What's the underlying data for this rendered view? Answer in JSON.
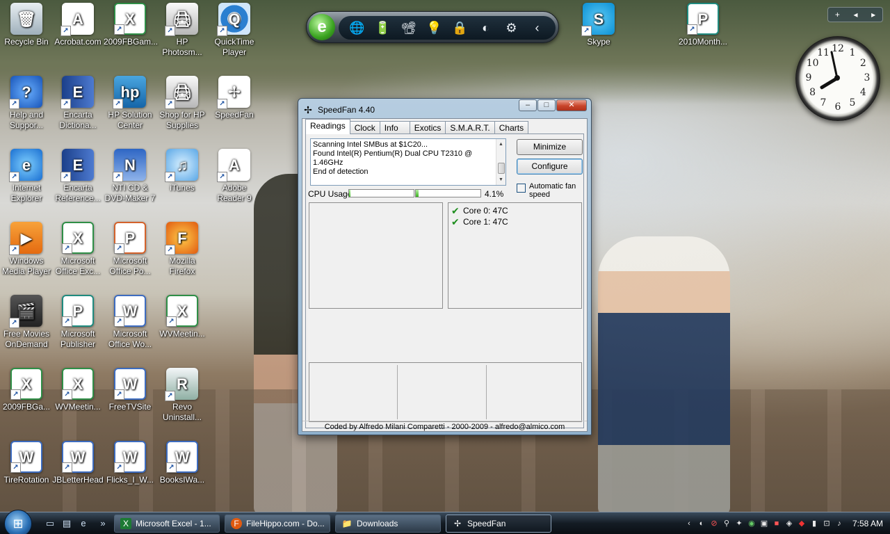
{
  "desktop": {
    "icons": [
      {
        "label": "Recycle Bin",
        "glyph": "🗑"
      },
      {
        "label": "Acrobat.com",
        "glyph": "A"
      },
      {
        "label": "2009FBGam...",
        "glyph": "X"
      },
      {
        "label": "HP Photosm...",
        "glyph": "🖨"
      },
      {
        "label": "QuickTime Player",
        "glyph": "Q"
      },
      {
        "label": "Help and Suppor...",
        "glyph": "?"
      },
      {
        "label": "Encarta Dictiona...",
        "glyph": "E"
      },
      {
        "label": "HP Solution Center",
        "glyph": "hp"
      },
      {
        "label": "Shop for HP Supplies",
        "glyph": "🖨"
      },
      {
        "label": "SpeedFan",
        "glyph": "✢"
      },
      {
        "label": "Internet Explorer",
        "glyph": "e"
      },
      {
        "label": "Encarta Reference...",
        "glyph": "E"
      },
      {
        "label": "NTI CD & DVD-Maker 7",
        "glyph": "N"
      },
      {
        "label": "iTunes",
        "glyph": "♫"
      },
      {
        "label": "Adobe Reader 9",
        "glyph": "A"
      },
      {
        "label": "Windows Media Player",
        "glyph": "▶"
      },
      {
        "label": "Microsoft Office Exc...",
        "glyph": "X"
      },
      {
        "label": "Microsoft Office Po...",
        "glyph": "P"
      },
      {
        "label": "Mozilla Firefox",
        "glyph": "F"
      },
      {
        "label": "Free Movies OnDemand",
        "glyph": "🎬"
      },
      {
        "label": "Microsoft Publisher",
        "glyph": "P"
      },
      {
        "label": "Microsoft Office Wo...",
        "glyph": "W"
      },
      {
        "label": "WVMeetin...",
        "glyph": "X"
      },
      {
        "label": "2009FBGa...",
        "glyph": "X"
      },
      {
        "label": "WVMeetin...",
        "glyph": "X"
      },
      {
        "label": "FreeTVSite",
        "glyph": "W"
      },
      {
        "label": "Revo Uninstall...",
        "glyph": "R"
      },
      {
        "label": "TireRotation",
        "glyph": "W"
      },
      {
        "label": "JBLetterHead",
        "glyph": "W"
      },
      {
        "label": "Flicks_I_W...",
        "glyph": "W"
      },
      {
        "label": "BooksIWa...",
        "glyph": "W"
      },
      {
        "label": "Skype",
        "glyph": "S"
      },
      {
        "label": "2010Month...",
        "glyph": "P"
      }
    ]
  },
  "dock": {
    "logo": "e",
    "buttons": [
      "🌐",
      "🔋",
      "📽",
      "💡",
      "🔒",
      "◐",
      "⚙",
      "‹"
    ]
  },
  "gadget_controls": {
    "add": "+",
    "prev": "◂",
    "next": "▸"
  },
  "clock": {
    "numbers": [
      "12",
      "1",
      "2",
      "3",
      "4",
      "5",
      "6",
      "7",
      "8",
      "9",
      "10",
      "11"
    ],
    "hour": 7,
    "minute": 58
  },
  "speedfan": {
    "title": "SpeedFan 4.40",
    "controls": {
      "minimize": "–",
      "maximize": "□",
      "close": "✕"
    },
    "tabs": [
      "Readings",
      "Clock",
      "Info",
      "Exotics",
      "S.M.A.R.T.",
      "Charts"
    ],
    "log_lines": [
      "Scanning Intel SMBus at $1C20...",
      "Found Intel(R) Pentium(R) Dual CPU T2310 @ 1.46GHz",
      "End of detection"
    ],
    "minimize_label": "Minimize",
    "configure_label": "Configure",
    "cpu_usage_label": "CPU Usage",
    "cpu_usage_pct": "4.1%",
    "cpu_bar_1": 0.02,
    "cpu_bar_2": 0.04,
    "auto_fan_label": "Automatic fan speed",
    "temps": [
      {
        "label": "Core 0: 47C"
      },
      {
        "label": "Core 1: 47C"
      }
    ],
    "status": "Coded by Alfredo Milani Comparetti - 2000-2009 - alfredo@almico.com"
  },
  "taskbar": {
    "tasks": [
      {
        "label": "Microsoft Excel - 1...",
        "icon": "X",
        "color": "#1d7a34"
      },
      {
        "label": "FileHippo.com - Do...",
        "icon": "F",
        "color": "#e05a10"
      },
      {
        "label": "Downloads",
        "icon": "📁",
        "color": "#d4a32a"
      },
      {
        "label": "SpeedFan",
        "icon": "✢",
        "color": "#ffffff"
      }
    ],
    "time": "7:58 AM"
  }
}
